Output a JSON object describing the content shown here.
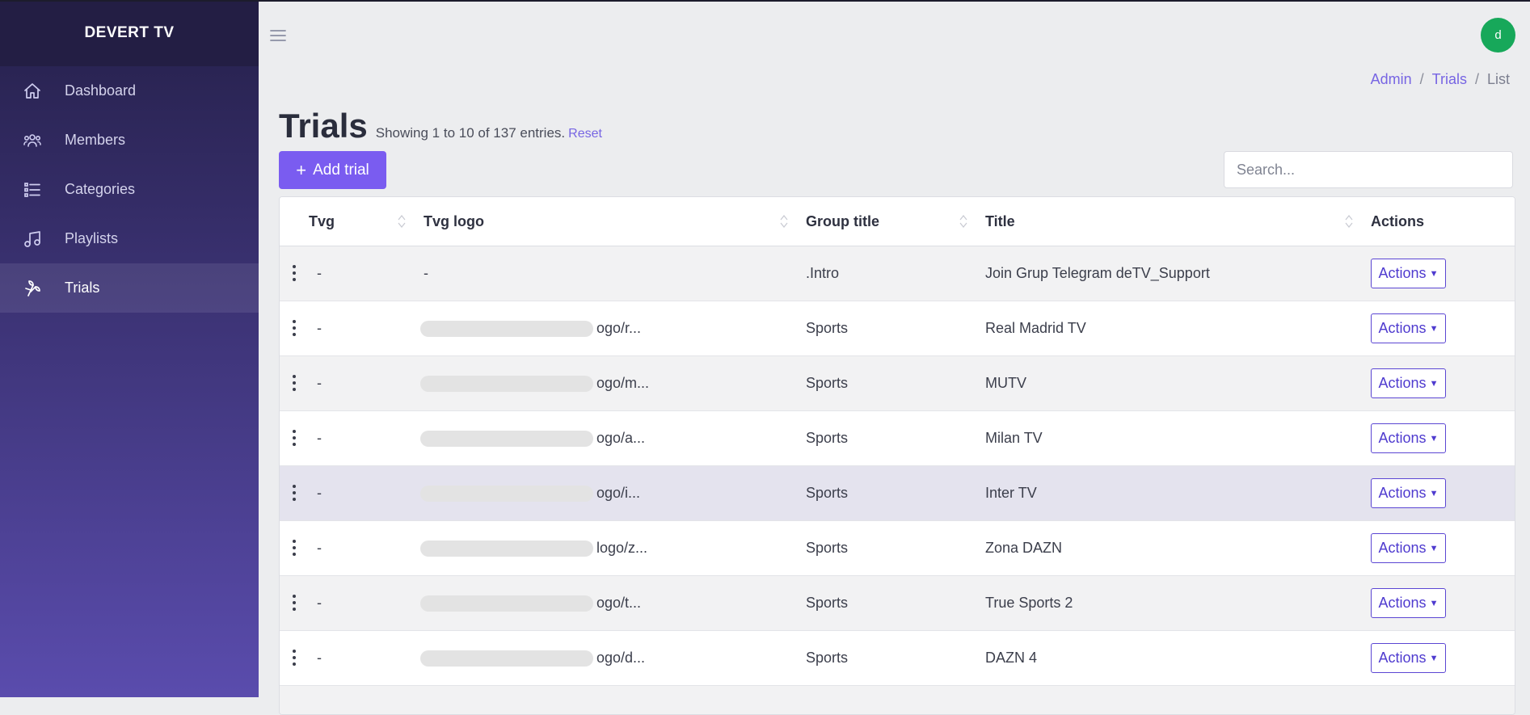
{
  "app": {
    "brand": "DEVERT TV"
  },
  "sidebar": {
    "items": [
      {
        "label": "Dashboard",
        "icon": "home-icon"
      },
      {
        "label": "Members",
        "icon": "users-icon"
      },
      {
        "label": "Categories",
        "icon": "list-icon"
      },
      {
        "label": "Playlists",
        "icon": "music-icon"
      },
      {
        "label": "Trials",
        "icon": "trials-icon",
        "active": true
      }
    ]
  },
  "header": {
    "avatar_letter": "d"
  },
  "breadcrumb": {
    "items": [
      "Admin",
      "Trials",
      "List"
    ],
    "separator": "/"
  },
  "page": {
    "title": "Trials",
    "entries": "Showing 1 to 10 of 137 entries.",
    "reset": "Reset",
    "add_label": "Add trial",
    "add_icon": "+",
    "search_placeholder": "Search..."
  },
  "table": {
    "columns": [
      "Tvg",
      "Tvg logo",
      "Group title",
      "Title",
      "Actions"
    ],
    "action_label": "Actions",
    "rows": [
      {
        "tvg": "-",
        "logo": "-",
        "group": ".Intro",
        "title": "Join Grup Telegram deTV_Support"
      },
      {
        "tvg": "-",
        "logo": "ogo/r...",
        "group": "Sports",
        "title": "Real Madrid TV"
      },
      {
        "tvg": "-",
        "logo": "ogo/m...",
        "group": "Sports",
        "title": "MUTV"
      },
      {
        "tvg": "-",
        "logo": "ogo/a...",
        "group": "Sports",
        "title": "Milan TV"
      },
      {
        "tvg": "-",
        "logo": "ogo/i...",
        "group": "Sports",
        "title": "Inter TV"
      },
      {
        "tvg": "-",
        "logo": "logo/z...",
        "group": "Sports",
        "title": "Zona DAZN"
      },
      {
        "tvg": "-",
        "logo": "ogo/t...",
        "group": "Sports",
        "title": "True Sports 2"
      },
      {
        "tvg": "-",
        "logo": "ogo/d...",
        "group": "Sports",
        "title": "DAZN 4"
      }
    ]
  },
  "colors": {
    "accent": "#7a5cf0",
    "sidebar_top": "#231e44",
    "sidebar_bottom": "#5a4cad",
    "avatar": "#17a85a"
  }
}
